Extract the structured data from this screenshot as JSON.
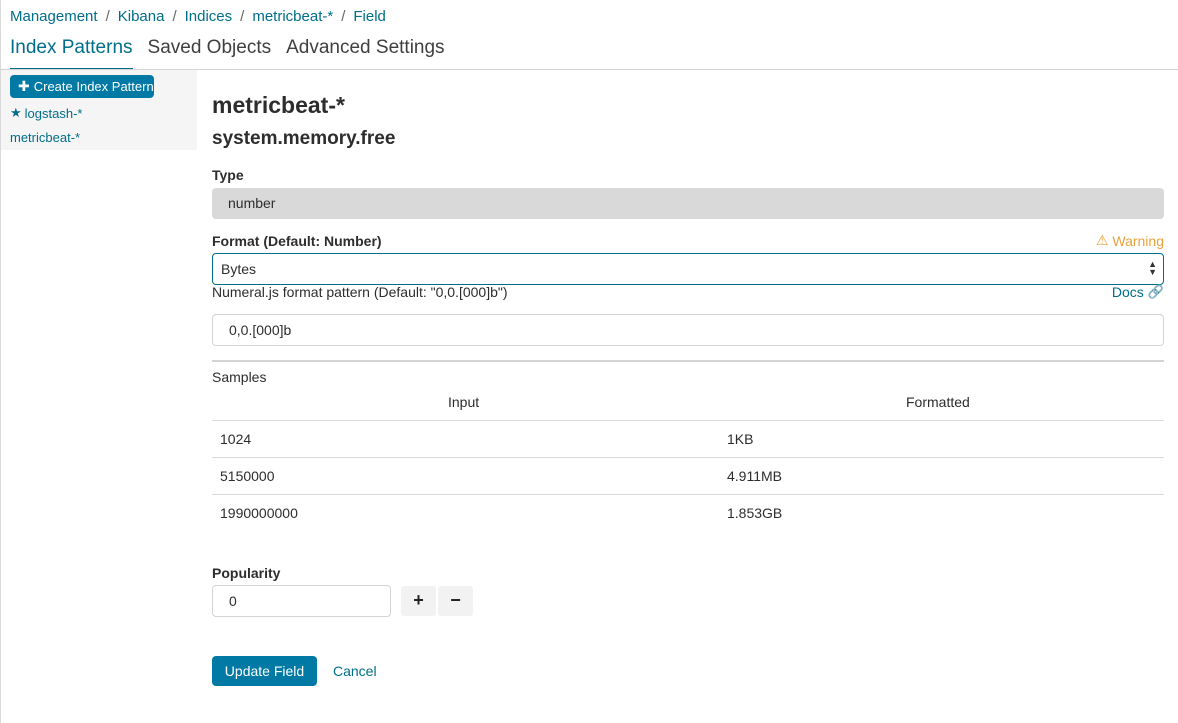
{
  "breadcrumb": {
    "items": [
      "Management",
      "Kibana",
      "Indices",
      "metricbeat-*",
      "Field"
    ],
    "separator": "/"
  },
  "tabs": [
    {
      "label": "Index Patterns",
      "active": true
    },
    {
      "label": "Saved Objects",
      "active": false
    },
    {
      "label": "Advanced Settings",
      "active": false
    }
  ],
  "sidebar": {
    "create_button": "Create Index Pattern",
    "patterns": [
      {
        "label": "logstash-*",
        "default": true,
        "icon": "star-icon"
      },
      {
        "label": "metricbeat-*",
        "default": false
      }
    ]
  },
  "main": {
    "index_title": "metricbeat-*",
    "field_name": "system.memory.free",
    "type_label": "Type",
    "type_value": "number",
    "format_label": "Format (Default: Number)",
    "warning_label": "Warning",
    "format_value": "Bytes",
    "pattern_label": "Numeral.js format pattern (Default: \"0,0.[000]b\")",
    "docs_label": "Docs",
    "pattern_value": "0,0.[000]b",
    "samples": {
      "label": "Samples",
      "headers": [
        "Input",
        "Formatted"
      ],
      "rows": [
        {
          "input": "1024",
          "formatted": "1KB"
        },
        {
          "input": "5150000",
          "formatted": "4.911MB"
        },
        {
          "input": "1990000000",
          "formatted": "1.853GB"
        }
      ]
    },
    "popularity_label": "Popularity",
    "popularity_value": "0",
    "increment_label": "+",
    "decrement_label": "−",
    "update_button": "Update Field",
    "cancel_link": "Cancel"
  },
  "colors": {
    "accent": "#006e8a",
    "button": "#0079a5",
    "warning": "#e8a23c"
  }
}
